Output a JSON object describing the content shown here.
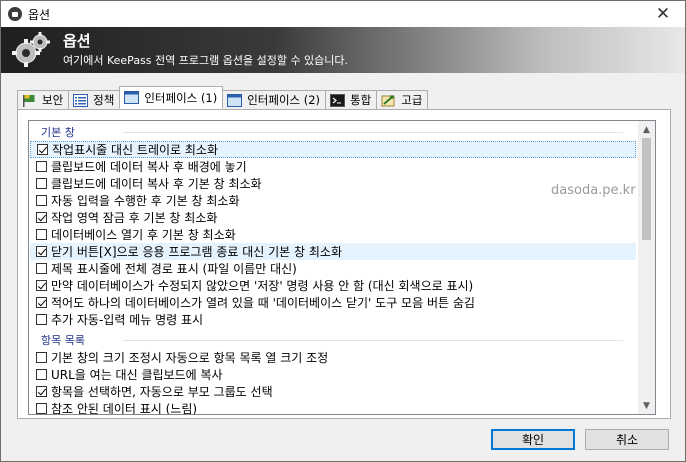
{
  "window": {
    "title": "옵션",
    "close_glyph": "✕"
  },
  "banner": {
    "heading": "옵션",
    "subtitle": "여기에서 KeePass 전역 프로그램 옵션을 설정할 수 있습니다."
  },
  "tabs": [
    {
      "label": "보안",
      "icon": "security-flag-icon"
    },
    {
      "label": "정책",
      "icon": "policy-list-icon"
    },
    {
      "label": "인터페이스 (1)",
      "icon": "interface-window-icon",
      "active": true
    },
    {
      "label": "인터페이스 (2)",
      "icon": "interface-window-icon"
    },
    {
      "label": "통합",
      "icon": "integration-console-icon"
    },
    {
      "label": "고급",
      "icon": "advanced-tools-icon"
    }
  ],
  "list": {
    "group1": "기본 창",
    "group2": "항목 목록",
    "items": [
      {
        "label": "작업표시줄 대신 트레이로 최소화",
        "checked": true
      },
      {
        "label": "클립보드에 데이터 복사 후 배경에 놓기",
        "checked": false
      },
      {
        "label": "클립보드에 데이터 복사 후 기본 창 최소화",
        "checked": false
      },
      {
        "label": "자동 입력을 수행한 후 기본 창 최소화",
        "checked": false
      },
      {
        "label": "작업 영역 잠금 후 기본 창 최소화",
        "checked": true
      },
      {
        "label": "데이터베이스 열기 후 기본 창 최소화",
        "checked": false
      },
      {
        "label": "닫기 버튼[X]으로 응용 프로그램 종료 대신 기본 창 최소화",
        "checked": true
      },
      {
        "label": "제목 표시줄에 전체 경로 표시 (파일 이름만 대신)",
        "checked": false
      },
      {
        "label": "만약 데이터베이스가 수정되지 않았으면 '저장' 명령 사용 안 함 (대신 회색으로 표시)",
        "checked": true
      },
      {
        "label": "적어도 하나의 데이터베이스가 열려 있을 때 '데이터베이스 닫기' 도구 모음 버튼 숨김",
        "checked": true
      },
      {
        "label": "추가 자동-입력 메뉴 명령 표시",
        "checked": false
      },
      {
        "label": "기본 창의 크기 조정시 자동으로 항목 목록 열 크기 조정",
        "checked": false
      },
      {
        "label": "URL을 여는 대신 클립보드에 복사",
        "checked": false
      },
      {
        "label": "항목을 선택하면, 자동으로 부모 그룹도 선택",
        "checked": true
      },
      {
        "label": "참조 안된 데이터 표시 (느림)",
        "checked": false
      }
    ]
  },
  "watermark": "dasoda.pe.kr",
  "buttons": {
    "ok": "확인",
    "cancel": "취소"
  }
}
